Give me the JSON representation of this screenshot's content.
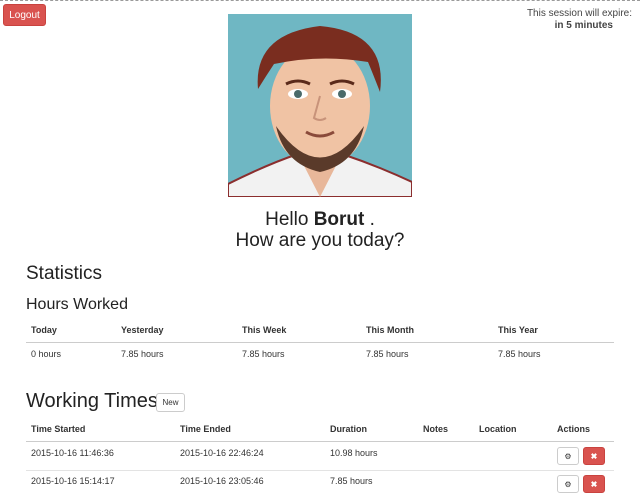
{
  "header": {
    "logout_label": "Logout",
    "session_line1": "This session will expire:",
    "session_line2": "in 5 minutes"
  },
  "greeting": {
    "hello": "Hello",
    "name": "Borut",
    "suffix": " .",
    "question": "How are you today?"
  },
  "statistics": {
    "title": "Statistics",
    "subtitle": "Hours Worked",
    "columns": [
      "Today",
      "Yesterday",
      "This Week",
      "This Month",
      "This Year"
    ],
    "values": [
      "0 hours",
      "7.85 hours",
      "7.85 hours",
      "7.85 hours",
      "7.85 hours"
    ]
  },
  "working_times": {
    "title": "Working Times",
    "new_label": "New",
    "columns": [
      "Time Started",
      "Time Ended",
      "Duration",
      "Notes",
      "Location",
      "Actions"
    ],
    "rows": [
      {
        "started": "2015-10-16 11:46:36",
        "ended": "2015-10-16 22:46:24",
        "duration": "10.98 hours",
        "notes": "",
        "location": ""
      },
      {
        "started": "2015-10-16 15:14:17",
        "ended": "2015-10-16 23:05:46",
        "duration": "7.85 hours",
        "notes": "",
        "location": ""
      }
    ],
    "gear_icon": "gear-icon",
    "delete_icon": "close-icon"
  },
  "colors": {
    "danger": "#d9534f",
    "avatar_bg": "#6fb7c3"
  }
}
